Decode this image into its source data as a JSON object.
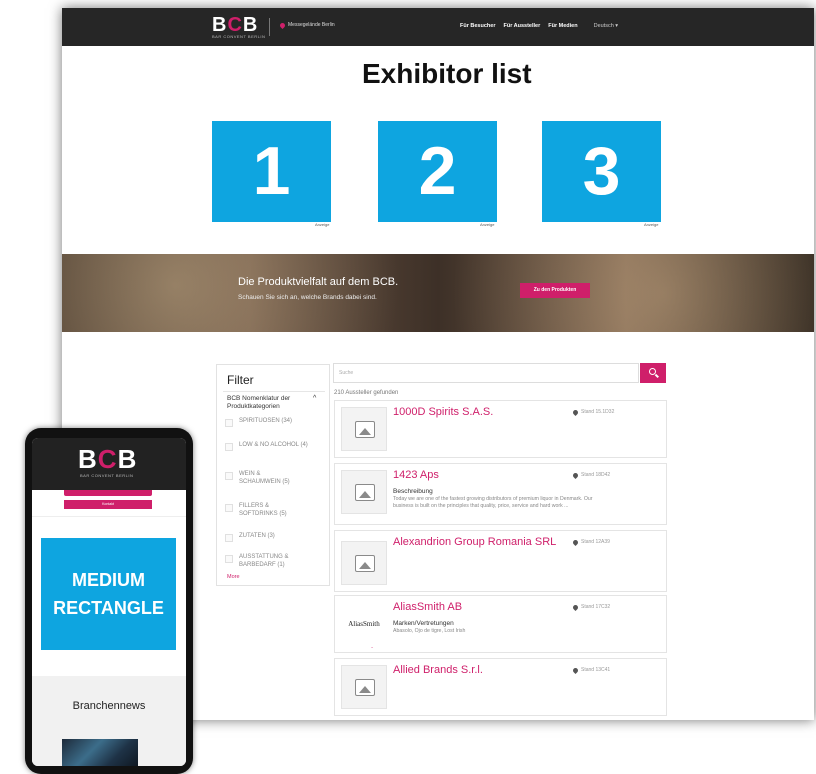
{
  "desktop": {
    "header": {
      "logo": "BCB",
      "logo_sub": "BAR CONVENT BERLIN",
      "location": "Messegelände Berlin",
      "nav": [
        "Für Besucher",
        "Für Aussteller",
        "Für Medien"
      ],
      "language": "Deutsch ▾"
    },
    "headline": "Exhibitor list",
    "ads": [
      {
        "number": "1",
        "label": "Anzeige"
      },
      {
        "number": "2",
        "label": "Anzeige"
      },
      {
        "number": "3",
        "label": "Anzeige"
      }
    ],
    "banner": {
      "title": "Die Produktvielfalt auf dem BCB.",
      "subtitle": "Schauen Sie sich an, welche Brands dabei sind.",
      "button": "Zu den Produkten"
    },
    "filter": {
      "title": "Filter",
      "category": "BCB Nomenklatur der Produktkategorien",
      "options": [
        "SPIRITUOSEN (34)",
        "LOW & NO ALCOHOL (4)",
        "WEIN & SCHAUMWEIN (5)",
        "FILLERS & SOFTDRINKS (5)",
        "ZUTATEN (3)",
        "AUSSTATTUNG & BARBEDARF (1)"
      ],
      "more": "More"
    },
    "search": {
      "placeholder": "Suche"
    },
    "result_count": "210 Aussteller gefunden",
    "exhibitors": [
      {
        "name": "1000D Spirits S.A.S.",
        "stand": "Stand 15.1D32",
        "label": "",
        "desc": ""
      },
      {
        "name": "1423 Aps",
        "stand": "Stand 18D42",
        "label": "Beschreibung",
        "desc": "Today we are one of the fastest growing distributors of premium liquor in Denmark. Our business is built on the principles that quality, price, service and hard work ..."
      },
      {
        "name": "Alexandrion Group Romania SRL",
        "stand": "Stand 12A39",
        "label": "",
        "desc": ""
      },
      {
        "name": "AliasSmith AB",
        "stand": "Stand 17C32",
        "label": "Marken/Vertretungen",
        "desc": "Abasolo, Ojo de tigre, Lost Irish"
      },
      {
        "name": "Allied Brands S.r.l.",
        "stand": "Stand 13C41",
        "label": "",
        "desc": ""
      }
    ],
    "alias_logo": "AliasSmith"
  },
  "phone": {
    "logo": "BCB",
    "logo_sub": "BAR CONVENT BERLIN",
    "button": "Kontakt",
    "ad_line1": "MEDIUM",
    "ad_line2": "RECTANGLE",
    "news_title": "Branchennews"
  },
  "colors": {
    "accent": "#cf1f6a",
    "ad_blue": "#0ea5e0",
    "header": "#262626"
  }
}
